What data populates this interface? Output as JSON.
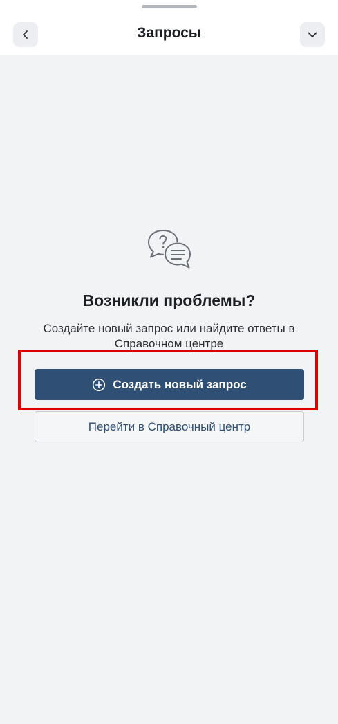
{
  "header": {
    "title": "Запросы",
    "back_icon": "chevron-left-icon",
    "collapse_icon": "chevron-down-icon"
  },
  "empty_state": {
    "icon": "chat-question-icon",
    "title": "Возникли проблемы?",
    "description": "Создайте новый запрос или найдите ответы в Справочном центре"
  },
  "actions": {
    "create_label": "Создать новый запрос",
    "create_icon": "plus-circle-icon",
    "help_center_label": "Перейти в Справочный центр"
  },
  "colors": {
    "primary": "#2f4f75",
    "highlight": "#e00000",
    "background": "#f2f3f5"
  }
}
